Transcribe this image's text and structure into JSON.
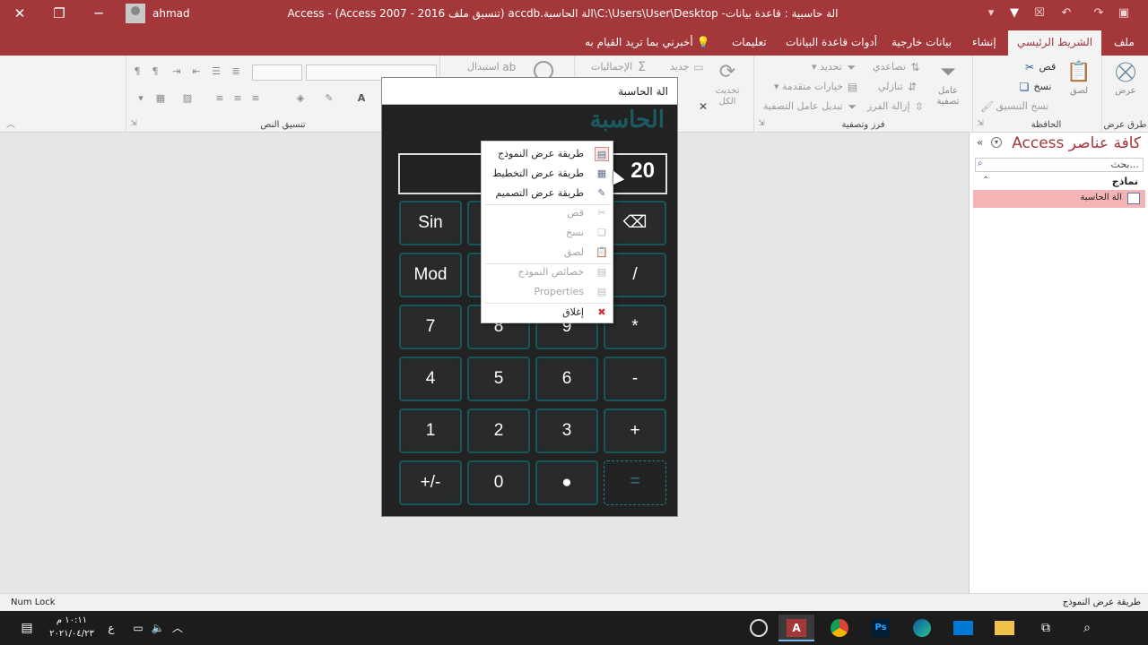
{
  "window": {
    "title": "الة حاسبية : قاعدة بيانات- C:\\Users\\User\\Desktop\\الة الحاسبة.accdb (تنسيق ملف Access 2007 - 2016)  -  Access",
    "user": "ahmad"
  },
  "tabs": [
    "ملف",
    "الشريط الرئيسي",
    "إنشاء",
    "بيانات خارجية",
    "أدوات قاعدة البيانات",
    "تعليمات"
  ],
  "tell_me": "أخبرني بما تريد القيام به",
  "ribbon": {
    "views_group": {
      "label": "طرق عرض",
      "view_button": "عرض"
    },
    "clipboard_group": {
      "label": "الحافظة",
      "paste": "لصق",
      "cut": "قص",
      "copy": "نسخ",
      "format_painter": "نسخ التنسيق"
    },
    "sort_filter_group": {
      "label": "فرز وتصفية",
      "filter": "عامل تصفية",
      "ascending": "تصاعدي",
      "descending": "تنازلي",
      "remove_sort": "إزالة الفرز",
      "selection": "تحديد",
      "advanced": "خيارات متقدمة",
      "toggle_filter": "تبديل عامل التصفية"
    },
    "records_group": {
      "refresh": "تحديث الكل",
      "new": "جديد",
      "totals": "الإجماليات"
    },
    "find_group": {
      "replace": "استبدال"
    },
    "text_format_group": {
      "label": "تنسيق النص"
    }
  },
  "form": {
    "window_title": "الة الحاسبة",
    "calc_title": "الحاسبة",
    "display_value": "20",
    "keys": [
      [
        "Sin",
        "",
        "",
        "⌫"
      ],
      [
        "Mod",
        "",
        "",
        "/"
      ],
      [
        "7",
        "8",
        "9",
        "*"
      ],
      [
        "4",
        "5",
        "6",
        "-"
      ],
      [
        "1",
        "2",
        "3",
        "+"
      ],
      [
        "+/-",
        "0",
        "●",
        "="
      ]
    ]
  },
  "context_menu": {
    "items": [
      {
        "label": "طريقة عرض النموذج",
        "icon": "form-view-icon",
        "enabled": true
      },
      {
        "label": "طريقة عرض التخطيط",
        "icon": "layout-view-icon",
        "enabled": true
      },
      {
        "label": "طريقة عرض التصميم",
        "icon": "design-view-icon",
        "enabled": true
      },
      {
        "label": "قص",
        "icon": "cut-icon",
        "enabled": false
      },
      {
        "label": "نسخ",
        "icon": "copy-icon",
        "enabled": false
      },
      {
        "label": "لصق",
        "icon": "paste-icon",
        "enabled": false
      },
      {
        "label": "خصائص النموذج",
        "icon": "form-properties-icon",
        "enabled": false
      },
      {
        "label": "Properties",
        "icon": "properties-icon",
        "enabled": false
      },
      {
        "label": "إغلاق",
        "icon": "close-icon",
        "enabled": true
      }
    ]
  },
  "nav_pane": {
    "title": "كافة عناصر Access",
    "search_placeholder": "بحث...",
    "section": "نماذج",
    "items": [
      "الة الحاسبة"
    ]
  },
  "status_bar": {
    "left": "Num Lock",
    "right": "طريقة عرض النموذج"
  },
  "taskbar": {
    "time": "١٠:١١ م",
    "date": "٢٠٢١/٠٤/٢٣",
    "lang": "ع",
    "apps": [
      "obs-icon",
      "access-icon",
      "chrome-icon",
      "photoshop-icon",
      "edge-icon",
      "mail-icon",
      "file-explorer-icon",
      "task-view-icon",
      "search-icon"
    ]
  }
}
